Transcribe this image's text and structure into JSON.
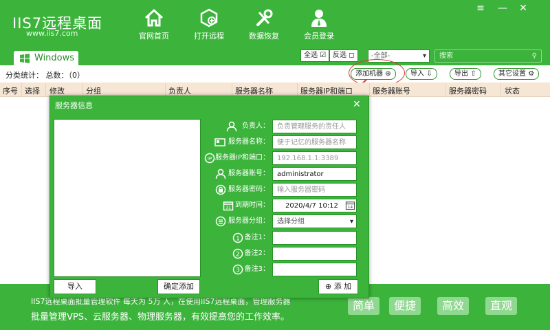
{
  "app": {
    "logo": "IIS7远程桌面",
    "url": "www.iis7.com"
  },
  "nav": [
    {
      "label": "官网首页",
      "icon": "home-icon"
    },
    {
      "label": "打开远程",
      "icon": "remote-icon"
    },
    {
      "label": "数据恢复",
      "icon": "tools-icon"
    },
    {
      "label": "会员登录",
      "icon": "user-icon"
    }
  ],
  "window_controls": {
    "menu": "≡",
    "minimize": "—",
    "close": "✕"
  },
  "tab": {
    "label": "Windows"
  },
  "toolbar": {
    "select_all": "全选",
    "invert": "反选",
    "group_select": "-全部-",
    "search_placeholder": "搜索"
  },
  "stats": {
    "text": "分类统计： 总数：（0）"
  },
  "actions": {
    "add": "添加机器",
    "import": "导入",
    "export": "导出",
    "settings": "其它设置"
  },
  "table": {
    "headers": [
      "序号",
      "选择",
      "修改",
      "分组",
      "负责人",
      "服务器名称",
      "服务器IP和端口",
      "服务器账号",
      "服务器密码",
      "状态"
    ]
  },
  "dialog": {
    "title": "服务器信息",
    "close": "✕",
    "import_button": "导入",
    "confirm_button": "确定添加",
    "add_button": "添 加",
    "fields": {
      "owner": {
        "label": "负责人：",
        "placeholder": "负责管理服务的责任人"
      },
      "name": {
        "label": "服务器名称：",
        "placeholder": "便于记忆的服务器名称"
      },
      "ip": {
        "label": "服务器IP和端口：",
        "placeholder": "192.168.1.1:3389"
      },
      "account": {
        "label": "服务器账号：",
        "value": "administrator"
      },
      "password": {
        "label": "服务器密码：",
        "placeholder": "输入服务器密码"
      },
      "expire": {
        "label": "到期时间：",
        "value": "2020/4/7 10:12"
      },
      "group": {
        "label": "服务器分组：",
        "value": "选择分组"
      },
      "note1": {
        "label": "备注1：",
        "value": ""
      },
      "note2": {
        "label": "备注2：",
        "value": ""
      },
      "note3": {
        "label": "备注3：",
        "value": ""
      }
    }
  },
  "bottom": {
    "line1": "IIS7远程桌面批量管理软件   每天为 5万 人，在使用IIS7远程桌面，管理服务器",
    "line2": "批量管理VPS、云服务器、物理服务器，有效提高您的工作效率。",
    "buttons": [
      "简单",
      "便捷",
      "高效",
      "直观"
    ]
  },
  "colors": {
    "brand_green": "#3cb43c",
    "header_beige": "#f6e7d5",
    "annotation_red": "#e03030"
  }
}
